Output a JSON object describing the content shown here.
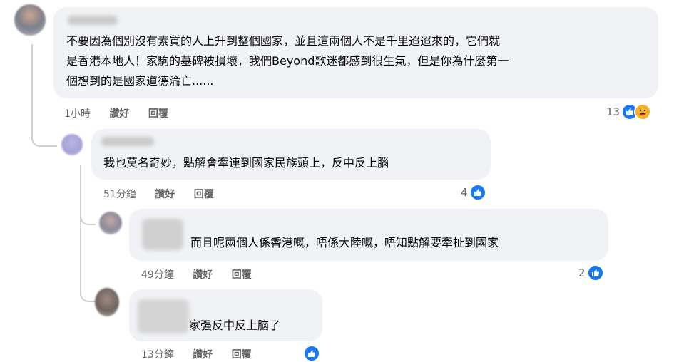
{
  "comments": [
    {
      "text_lines": [
        "不要因為個別沒有素質的人上升到整個國家，並且這兩個人不是千里迢迢來的，它們就",
        "是香港本地人！家駒的墓碑被損壞，我們Beyond歌迷都感到很生氣，但是你為什麼第一",
        "個想到的是國家道德淪亡......"
      ],
      "time": "1小時",
      "like_label": "讚好",
      "reply_label": "回覆",
      "reaction_count": "13",
      "reactions": [
        "like-icon",
        "haha-icon"
      ]
    },
    {
      "text": "我也莫名奇妙，點解會牽連到國家民族頭上，反中反上腦",
      "time": "51分鐘",
      "like_label": "讚好",
      "reply_label": "回覆",
      "reaction_count": "4",
      "reactions": [
        "like-icon"
      ]
    },
    {
      "text": "而且呢兩個人係香港嘅，唔係大陸嘅，唔知點解要牽扯到國家",
      "time": "49分鐘",
      "like_label": "讚好",
      "reply_label": "回覆",
      "reaction_count": "2",
      "reactions": [
        "like-icon"
      ]
    },
    {
      "text": "家强反中反上脑了",
      "time": "13分鐘",
      "like_label": "讚好",
      "reply_label": "回覆",
      "reaction_count": "",
      "reactions": [
        "like-icon"
      ]
    }
  ],
  "colors": {
    "bubble": "#f0f2f5",
    "meta": "#65676b",
    "like": "#1877f2",
    "haha": "#f7b125"
  }
}
